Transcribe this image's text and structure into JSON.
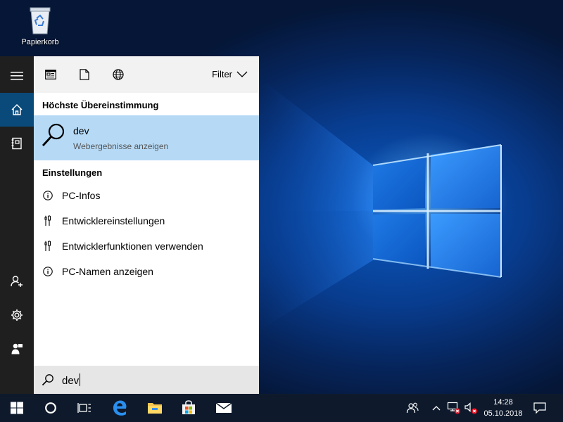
{
  "desktop": {
    "icons": [
      {
        "label": "Papierkorb",
        "icon": "recycle-bin-icon"
      }
    ]
  },
  "start_rail": {
    "items": [
      {
        "icon": "hamburger-menu-icon"
      },
      {
        "icon": "home-icon",
        "active": true
      },
      {
        "icon": "notebook-icon"
      },
      {
        "icon": "add-person-icon"
      },
      {
        "icon": "gear-icon"
      },
      {
        "icon": "feedback-icon"
      }
    ]
  },
  "search_panel": {
    "toolbar": {
      "icons": [
        "apps-icon",
        "document-icon",
        "globe-icon"
      ],
      "filter_label": "Filter"
    },
    "best_match_header": "Höchste Übereinstimmung",
    "best_match": {
      "title": "dev",
      "subtitle": "Webergebnisse anzeigen",
      "icon": "search-icon"
    },
    "settings_header": "Einstellungen",
    "settings_items": [
      {
        "label": "PC-Infos",
        "icon": "info-icon"
      },
      {
        "label": "Entwicklereinstellungen",
        "icon": "developer-tools-icon"
      },
      {
        "label": "Entwicklerfunktionen verwenden",
        "icon": "developer-tools-icon"
      },
      {
        "label": "PC-Namen anzeigen",
        "icon": "info-icon"
      }
    ],
    "search_input": {
      "value": "dev"
    }
  },
  "taskbar": {
    "pinned": [
      "windows-start-icon",
      "cortana-icon",
      "task-view-icon",
      "edge-icon",
      "file-explorer-icon",
      "store-icon",
      "mail-icon"
    ],
    "tray": {
      "icons": [
        "people-icon",
        "chevron-up-icon",
        "network-disconnected-icon",
        "volume-muted-icon",
        "action-center-icon"
      ],
      "time": "14:28",
      "date": "05.10.2018"
    }
  },
  "colors": {
    "accent": "#0a4a7a",
    "selection": "#b6daf6",
    "taskbar": "#0e1a2c",
    "rail": "#1f1f1f"
  }
}
